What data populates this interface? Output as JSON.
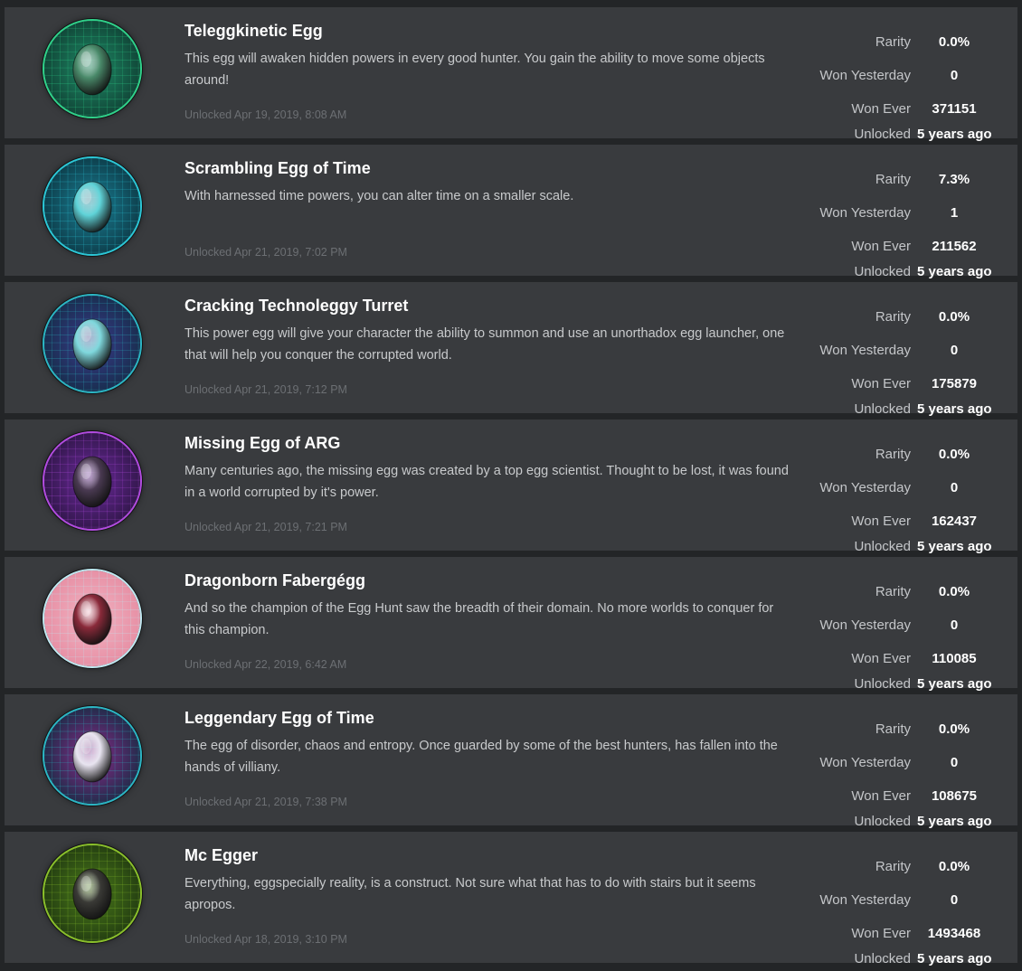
{
  "labels": {
    "rarity": "Rarity",
    "won_yesterday": "Won Yesterday",
    "won_ever": "Won Ever",
    "unlocked": "Unlocked"
  },
  "badges": [
    {
      "name": "Teleggkinetic Egg",
      "description": "This egg will awaken hidden powers in every good hunter. You gain the ability to move some objects around!",
      "unlocked_date": "Unlocked Apr 19, 2019, 8:08 AM",
      "rarity": "0.0%",
      "won_yesterday": "0",
      "won_ever": "371151",
      "unlocked_ago": "5 years ago",
      "icon": "teleggkinetic-egg-icon",
      "colors": {
        "ring": "#2fd28a",
        "bg": "#0e3b30",
        "glow": "#1f8a66",
        "egg": "#4a8a6a"
      }
    },
    {
      "name": "Scrambling Egg of Time",
      "description": "With harnessed time powers, you can alter time on a smaller scale.",
      "unlocked_date": "Unlocked Apr 21, 2019, 7:02 PM",
      "rarity": "7.3%",
      "won_yesterday": "1",
      "won_ever": "211562",
      "unlocked_ago": "5 years ago",
      "icon": "scrambling-egg-of-time-icon",
      "colors": {
        "ring": "#2bc7d6",
        "bg": "#0b3440",
        "glow": "#1b7f94",
        "egg": "#5fd3d8"
      }
    },
    {
      "name": "Cracking Technoleggy Turret",
      "description": "This power egg will give your character the ability to summon and use an unorthadox egg launcher, one that will help you conquer the corrupted world.",
      "unlocked_date": "Unlocked Apr 21, 2019, 7:12 PM",
      "rarity": "0.0%",
      "won_yesterday": "0",
      "won_ever": "175879",
      "unlocked_ago": "5 years ago",
      "icon": "cracking-technoleggy-turret-icon",
      "colors": {
        "ring": "#2bb6c4",
        "bg": "#132c45",
        "glow": "#3a3a8a",
        "egg": "#7fd8dd"
      }
    },
    {
      "name": "Missing Egg of ARG",
      "description": "Many centuries ago, the missing egg was created by a top egg scientist. Thought to be lost, it was found in a world corrupted by it's power.",
      "unlocked_date": "Unlocked Apr 21, 2019, 7:21 PM",
      "rarity": "0.0%",
      "won_yesterday": "0",
      "won_ever": "162437",
      "unlocked_ago": "5 years ago",
      "icon": "missing-egg-of-arg-icon",
      "colors": {
        "ring": "#b24be0",
        "bg": "#2a1440",
        "glow": "#6a2a9a",
        "egg": "#4a3a52"
      }
    },
    {
      "name": "Dragonborn Fabergégg",
      "description": "And so the champion of the Egg Hunt saw the breadth of their domain. No more worlds to conquer for this champion.",
      "unlocked_date": "Unlocked Apr 22, 2019, 6:42 AM",
      "rarity": "0.0%",
      "won_yesterday": "0",
      "won_ever": "110085",
      "unlocked_ago": "5 years ago",
      "icon": "dragonborn-fabergegg-icon",
      "colors": {
        "ring": "#bfe8f0",
        "bg": "#e58aa0",
        "glow": "#f2b3c2",
        "egg": "#8a2a3a"
      }
    },
    {
      "name": "Leggendary Egg of Time",
      "description": "The egg of disorder, chaos and entropy. Once guarded by some of the best hunters, has fallen into the hands of villiany.",
      "unlocked_date": "Unlocked Apr 21, 2019, 7:38 PM",
      "rarity": "0.0%",
      "won_yesterday": "0",
      "won_ever": "108675",
      "unlocked_ago": "5 years ago",
      "icon": "leggendary-egg-of-time-icon",
      "colors": {
        "ring": "#2bb6c4",
        "bg": "#102c40",
        "glow": "#8a2a8a",
        "egg": "#e8e4f0"
      }
    },
    {
      "name": "Mc Egger",
      "description": "Everything, eggspecially reality, is a construct. Not sure what that has to do with stairs but it seems apropos.",
      "unlocked_date": "Unlocked Apr 18, 2019, 3:10 PM",
      "rarity": "0.0%",
      "won_yesterday": "0",
      "won_ever": "1493468",
      "unlocked_ago": "5 years ago",
      "icon": "mc-egger-icon",
      "colors": {
        "ring": "#8ac02a",
        "bg": "#1e3510",
        "glow": "#4a7a1a",
        "egg": "#3a3a36"
      }
    }
  ]
}
